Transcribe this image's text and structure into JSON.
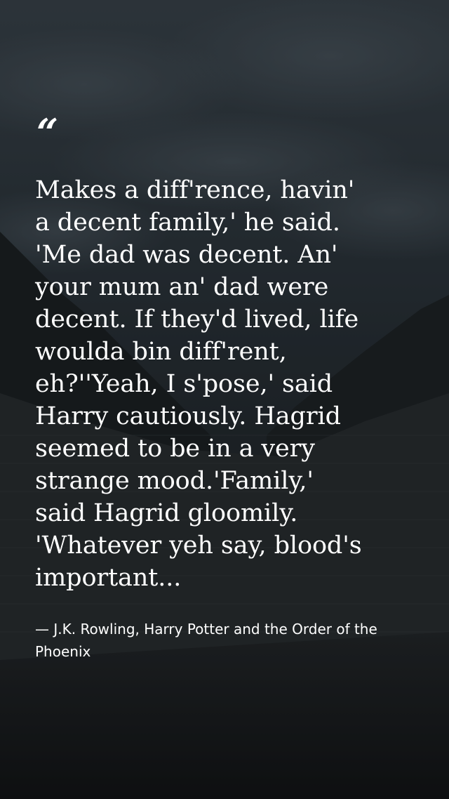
{
  "quote": {
    "mark": "“",
    "text": "Makes a diff'rence, havin'\na decent family,' he said.\n'Me dad was decent. An'\nyour mum an' dad were\ndecent. If they'd lived, life\nwoulda bin diff'rent,\neh?''Yeah, I s'pose,' said\nHarry cautiously. Hagrid\nseemed to be in a very\nstrange mood.'Family,'\nsaid Hagrid gloomily.\n'Whatever yeh say, blood's\nimportant...",
    "attribution": "— J.K. Rowling, Harry Potter and the Order of the Phoenix"
  },
  "colors": {
    "text": "#ffffff",
    "overlay": "#000000"
  }
}
